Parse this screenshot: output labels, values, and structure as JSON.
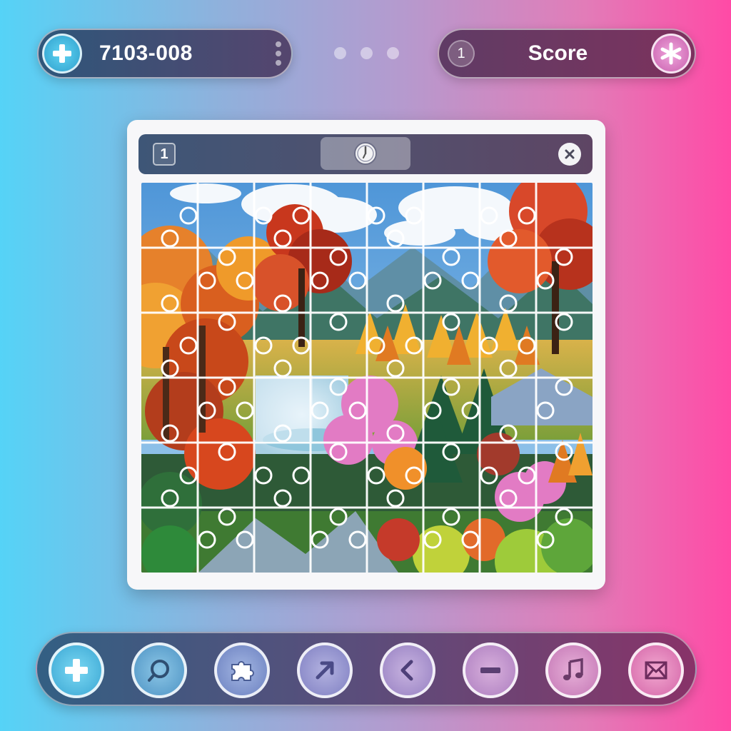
{
  "header": {
    "puzzle_code": "7103-008",
    "level_badge": "1",
    "score_label": "Score",
    "add_icon": "plus-icon",
    "score_icon": "star-icon",
    "menu_icon": "kebab-menu-icon"
  },
  "window": {
    "level_label": "1",
    "timer_icon": "clock-icon",
    "close_icon": "close-icon"
  },
  "toolbar": {
    "buttons": [
      {
        "name": "add-button",
        "icon": "plus-icon"
      },
      {
        "name": "search-button",
        "icon": "magnifier-icon"
      },
      {
        "name": "pieces-button",
        "icon": "puzzle-piece-icon"
      },
      {
        "name": "share-button",
        "icon": "arrow-up-right-icon"
      },
      {
        "name": "back-button",
        "icon": "chevron-left-icon"
      },
      {
        "name": "zoom-out-button",
        "icon": "minus-icon"
      },
      {
        "name": "music-button",
        "icon": "music-note-icon"
      },
      {
        "name": "mail-button",
        "icon": "envelope-icon"
      }
    ]
  },
  "board": {
    "columns": 8,
    "rows": 6,
    "missing_pieces": 1
  },
  "colors": {
    "accent_cyan": "#55d3f7",
    "accent_pink": "#ff4aa6",
    "bar_dark": "#3e5677"
  }
}
